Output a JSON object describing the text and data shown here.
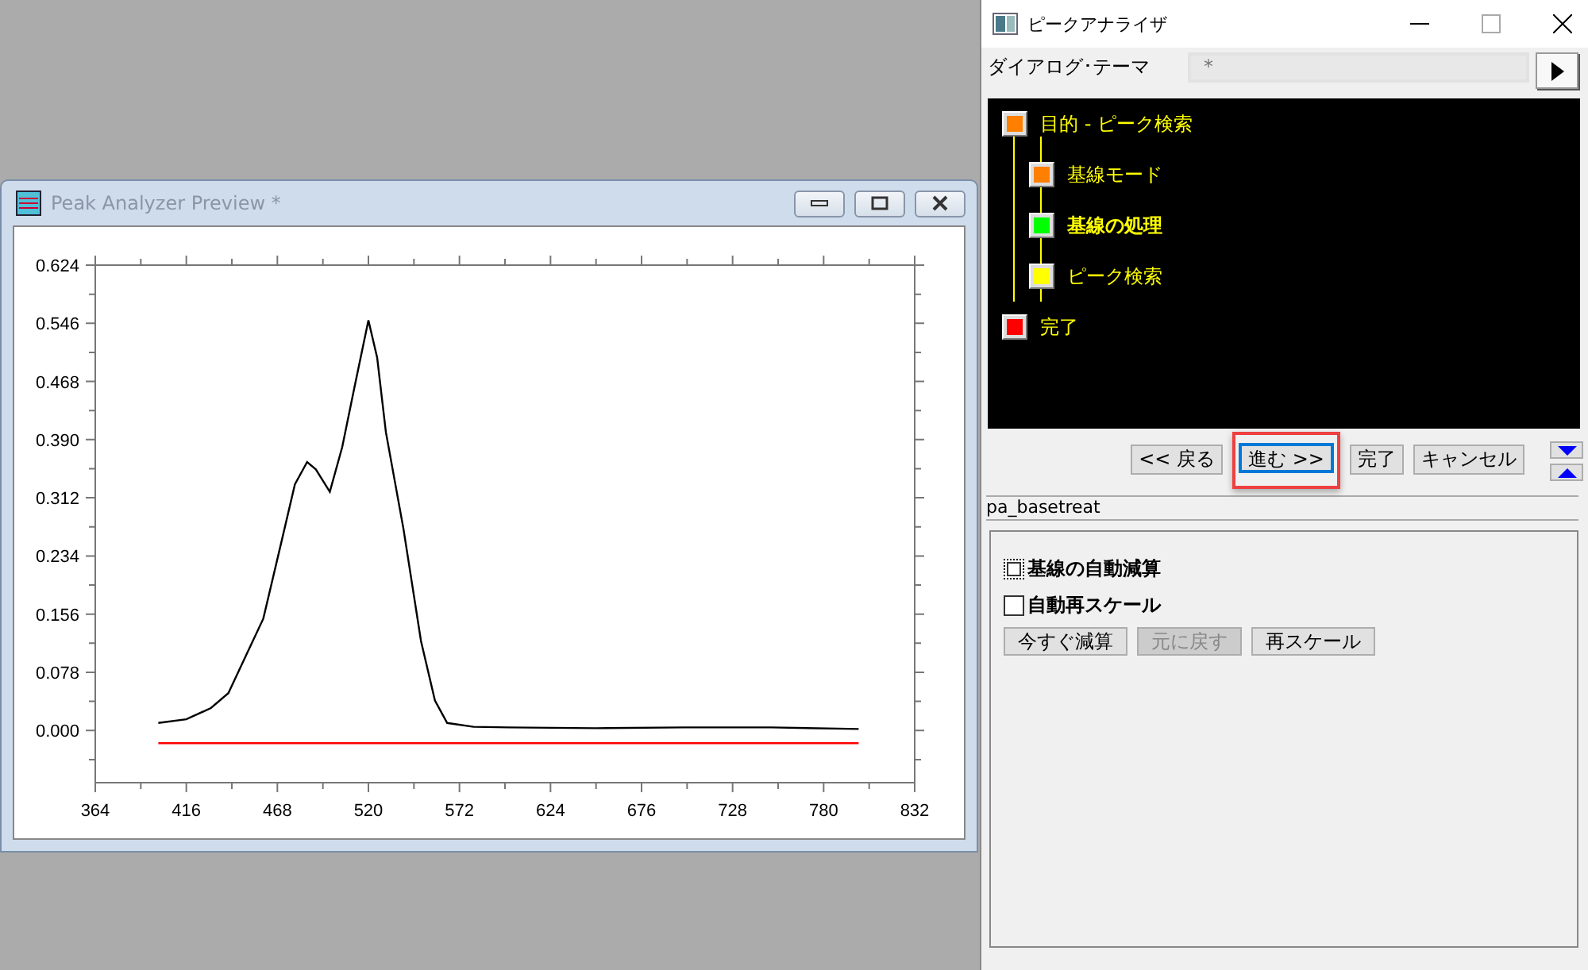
{
  "preview_window": {
    "title": "Peak Analyzer Preview *",
    "chart_data": {
      "type": "line",
      "xlim": [
        364,
        832
      ],
      "ylim": [
        -0.07,
        0.624
      ],
      "xticks": [
        364,
        416,
        468,
        520,
        572,
        624,
        676,
        728,
        780,
        832
      ],
      "yticks": [
        {
          "value": 0,
          "label": "0.000"
        },
        {
          "value": 0.078,
          "label": "0.078"
        },
        {
          "value": 0.156,
          "label": "0.156"
        },
        {
          "value": 0.234,
          "label": "0.234"
        },
        {
          "value": 0.312,
          "label": "0.312"
        },
        {
          "value": 0.39,
          "label": "0.390"
        },
        {
          "value": 0.468,
          "label": "0.468"
        },
        {
          "value": 0.546,
          "label": "0.546"
        },
        {
          "value": 0.624,
          "label": "0.624"
        }
      ],
      "x": [
        400,
        416,
        430,
        440,
        450,
        460,
        470,
        478,
        485,
        490,
        498,
        505,
        512,
        520,
        525,
        530,
        540,
        550,
        558,
        565,
        580,
        600,
        650,
        700,
        750,
        800
      ],
      "series": [
        {
          "color": "#000000",
          "values": [
            0.01,
            0.015,
            0.03,
            0.05,
            0.1,
            0.15,
            0.25,
            0.33,
            0.36,
            0.35,
            0.32,
            0.38,
            0.46,
            0.55,
            0.5,
            0.4,
            0.27,
            0.12,
            0.04,
            0.01,
            0.005,
            0.004,
            0.003,
            0.004,
            0.004,
            0.002
          ]
        },
        {
          "color": "#ff0000",
          "values": [
            -0.017,
            -0.017,
            -0.017,
            -0.017,
            -0.017,
            -0.017,
            -0.017,
            -0.017,
            -0.017,
            -0.017,
            -0.017,
            -0.017,
            -0.017,
            -0.017,
            -0.017,
            -0.017,
            -0.017,
            -0.017,
            -0.017,
            -0.017,
            -0.017,
            -0.017,
            -0.017,
            -0.017,
            -0.017,
            -0.017
          ]
        }
      ]
    }
  },
  "dialog": {
    "title": "ピークアナライザ",
    "theme_label": "ダイアログ･テーマ",
    "theme_value": "*",
    "steps": [
      {
        "label": "目的 - ピーク検索",
        "color": "#ff8000",
        "current": false,
        "children": [
          {
            "label": "基線モード",
            "color": "#ff8000",
            "current": false
          },
          {
            "label": "基線の処理",
            "color": "#00ff00",
            "current": true
          },
          {
            "label": "ピーク検索",
            "color": "#ffff00",
            "current": false
          }
        ]
      },
      {
        "label": "完了",
        "color": "#ff0000",
        "current": false
      }
    ],
    "nav_buttons": [
      {
        "label": "<< 戻る",
        "highlighted": false
      },
      {
        "label": "進む >>",
        "highlighted": true
      },
      {
        "label": "完了",
        "highlighted": false
      },
      {
        "label": "キャンセル",
        "highlighted": false
      }
    ],
    "page_name": "pa_basetreat",
    "options": [
      {
        "label": "基線の自動減算",
        "checked": false,
        "focused": true
      },
      {
        "label": "自動再スケール",
        "checked": false,
        "focused": false
      }
    ],
    "action_buttons": [
      {
        "label": "今すぐ減算",
        "disabled": false
      },
      {
        "label": "元に戻す",
        "disabled": true
      },
      {
        "label": "再スケール",
        "disabled": false
      }
    ]
  }
}
